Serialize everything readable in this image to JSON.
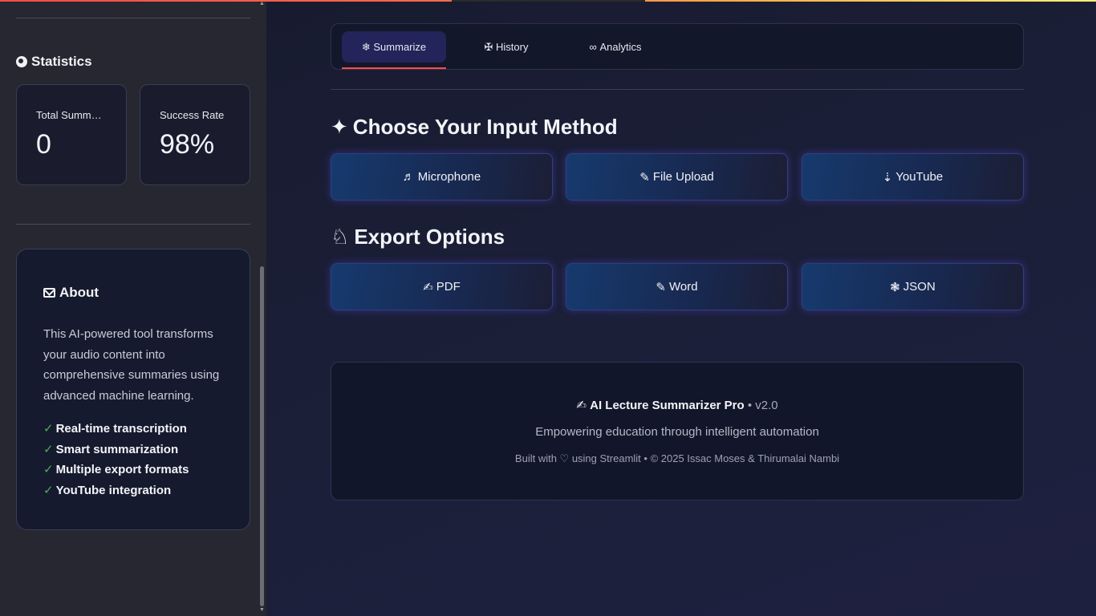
{
  "sidebar": {
    "statistics_heading": "Statistics",
    "stats": [
      {
        "label": "Total Summ…",
        "value": "0"
      },
      {
        "label": "Success Rate",
        "value": "98%"
      }
    ],
    "about": {
      "title": "About",
      "description": "This AI-powered tool transforms your audio content into comprehensive summaries using advanced machine learning.",
      "features": [
        "Real-time transcription",
        "Smart summarization",
        "Multiple export formats",
        "YouTube integration"
      ],
      "check_glyph": "✓"
    }
  },
  "tabs": [
    {
      "icon": "❄",
      "label": "Summarize",
      "active": true
    },
    {
      "icon": "✠",
      "label": "History",
      "active": false
    },
    {
      "icon": "∞",
      "label": "Analytics",
      "active": false
    }
  ],
  "input_section": {
    "icon": "✦",
    "title": "Choose Your Input Method",
    "buttons": [
      {
        "icon": "♬",
        "label": "Microphone"
      },
      {
        "icon": "✎",
        "label": "File Upload"
      },
      {
        "icon": "⇣",
        "label": "YouTube"
      }
    ]
  },
  "export_section": {
    "icon": "♘",
    "title": "Export Options",
    "buttons": [
      {
        "icon": "✍",
        "label": "PDF"
      },
      {
        "icon": "✎",
        "label": "Word"
      },
      {
        "icon": "❃",
        "label": "JSON"
      }
    ]
  },
  "footer": {
    "icon": "✍",
    "brand": "AI Lecture Summarizer Pro",
    "version": "• v2.0",
    "tagline": "Empowering education through intelligent automation",
    "credit": "Built with ♡ using Streamlit • © 2025 Issac Moses & Thirumalai Nambi"
  },
  "colors": {
    "accent_red": "#ff4b4b",
    "active_tab_bg": "#23245a",
    "check_green": "#4caf50"
  }
}
